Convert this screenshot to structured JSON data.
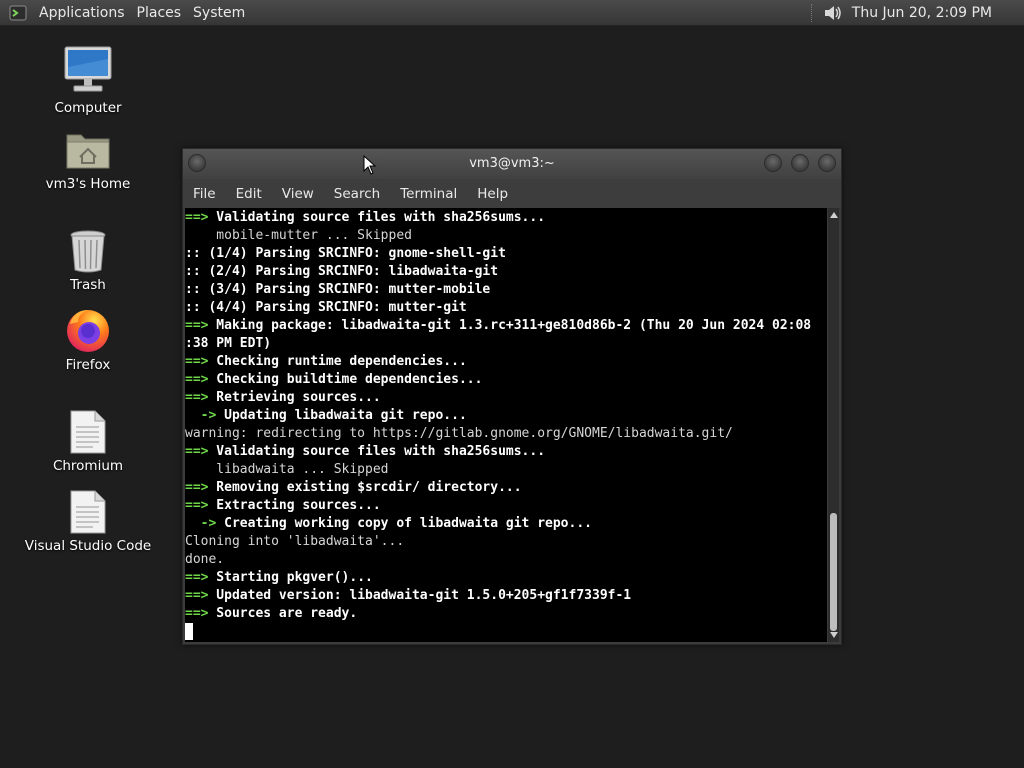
{
  "panel": {
    "menus": [
      "Applications",
      "Places",
      "System"
    ],
    "clock": "Thu Jun 20,  2:09 PM",
    "icons": {
      "logo": "terminal-logo-icon",
      "volume": "speaker-volume-icon"
    }
  },
  "desktop": {
    "icons": [
      {
        "label": "Computer",
        "icon": "computer-icon"
      },
      {
        "label": "vm3's Home",
        "icon": "home-folder-icon"
      },
      {
        "label": "Trash",
        "icon": "trash-icon"
      },
      {
        "label": "Firefox",
        "icon": "firefox-icon"
      },
      {
        "label": "Chromium",
        "icon": "document-icon"
      },
      {
        "label": "Visual Studio Code",
        "icon": "document-icon"
      }
    ]
  },
  "terminal": {
    "title": "vm3@vm3:~",
    "menu": [
      "File",
      "Edit",
      "View",
      "Search",
      "Terminal",
      "Help"
    ],
    "lines": [
      {
        "prefix": "==>",
        "text": " Validating source files with sha256sums...",
        "style": "bold"
      },
      {
        "prefix": "",
        "text": "    mobile-mutter ... Skipped",
        "style": "plain"
      },
      {
        "prefix": "",
        "text": ":: (1/4) Parsing SRCINFO: gnome-shell-git",
        "style": "bold"
      },
      {
        "prefix": "",
        "text": ":: (2/4) Parsing SRCINFO: libadwaita-git",
        "style": "bold"
      },
      {
        "prefix": "",
        "text": ":: (3/4) Parsing SRCINFO: mutter-mobile",
        "style": "bold"
      },
      {
        "prefix": "",
        "text": ":: (4/4) Parsing SRCINFO: mutter-git",
        "style": "bold"
      },
      {
        "prefix": "==>",
        "text": " Making package: libadwaita-git 1.3.rc+311+ge810d86b-2 (Thu 20 Jun 2024 02:08",
        "style": "bold"
      },
      {
        "prefix": "",
        "text": ":38 PM EDT)",
        "style": "bold"
      },
      {
        "prefix": "==>",
        "text": " Checking runtime dependencies...",
        "style": "bold"
      },
      {
        "prefix": "==>",
        "text": " Checking buildtime dependencies...",
        "style": "bold"
      },
      {
        "prefix": "==>",
        "text": " Retrieving sources...",
        "style": "bold"
      },
      {
        "prefix": "  ->",
        "text": " Updating libadwaita git repo...",
        "style": "bold"
      },
      {
        "prefix": "",
        "text": "warning: redirecting to https://gitlab.gnome.org/GNOME/libadwaita.git/",
        "style": "plain"
      },
      {
        "prefix": "==>",
        "text": " Validating source files with sha256sums...",
        "style": "bold"
      },
      {
        "prefix": "",
        "text": "    libadwaita ... Skipped",
        "style": "plain"
      },
      {
        "prefix": "==>",
        "text": " Removing existing $srcdir/ directory...",
        "style": "bold"
      },
      {
        "prefix": "==>",
        "text": " Extracting sources...",
        "style": "bold"
      },
      {
        "prefix": "  ->",
        "text": " Creating working copy of libadwaita git repo...",
        "style": "bold"
      },
      {
        "prefix": "",
        "text": "Cloning into 'libadwaita'...",
        "style": "plain"
      },
      {
        "prefix": "",
        "text": "done.",
        "style": "plain"
      },
      {
        "prefix": "==>",
        "text": " Starting pkgver()...",
        "style": "bold"
      },
      {
        "prefix": "==>",
        "text": " Updated version: libadwaita-git 1.5.0+205+gf1f7339f-1",
        "style": "bold"
      },
      {
        "prefix": "==>",
        "text": " Sources are ready.",
        "style": "bold"
      }
    ]
  },
  "colors": {
    "desktop_bg": "#1e1e1e",
    "terminal_bg": "#000000",
    "prompt_arrow": "#6fd84a",
    "panel_bg": "#3f3f3f"
  }
}
